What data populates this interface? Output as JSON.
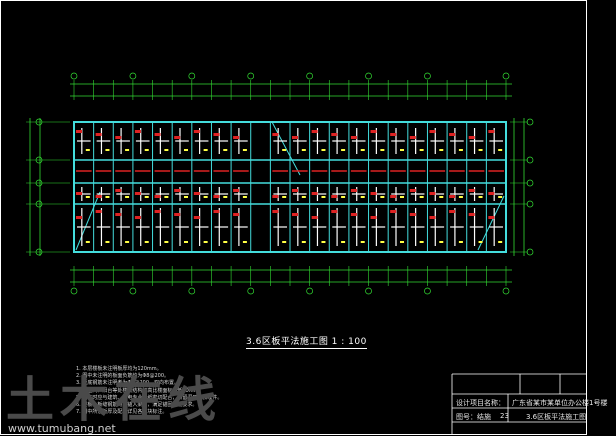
{
  "drawing": {
    "plan_title": "3.6区板平法施工图 1 : 100",
    "notes": [
      "1. 本层楼板未注明板厚均为120mm。",
      "2. 图中未注明的板面负筋均为Φ8@200。",
      "3. 板底钢筋未注明者为Φ8@200，双向布置。",
      "4. 卫生间、阳台等处楼板结构标高比楼面标高低50mm。",
      "5. 施工时应与建筑、水电专业图纸密切配合，预留洞口及预埋件。",
      "6. 楼板、板缝钢筋均应锚入梁内，满足锚固长度要求。",
      "7. 图中所注板厚及配筋详见各板块标注。"
    ]
  },
  "title_block": {
    "project_label": "设计项目名称：",
    "project_name": "广东省某市某单位办公楼1号楼",
    "drawing_name": "3.6区板平法施工图",
    "drawing_no_label": "图号：结施",
    "drawing_no": "23"
  },
  "watermark": {
    "logo_text": "土木在线",
    "url": "www.tumubang.net"
  },
  "colors": {
    "background": "#000000",
    "frame": "#ffffff",
    "walls": "#44dddd",
    "dimensions": "#33dd33",
    "rebar": "#ffffff",
    "beam_marks": "#dd2222",
    "labels": "#ffff44"
  }
}
